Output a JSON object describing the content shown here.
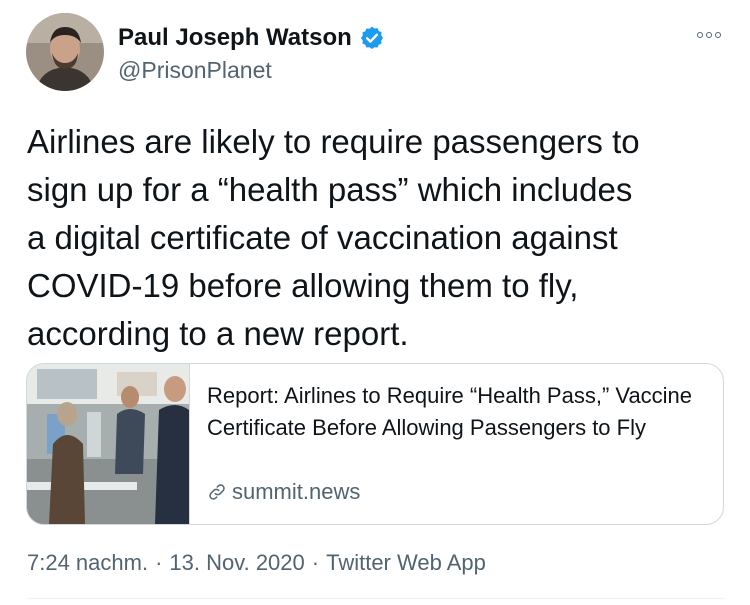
{
  "author": {
    "display_name": "Paul Joseph Watson",
    "handle": "@PrisonPlanet",
    "verified_icon": "verified-badge-icon",
    "avatar_icon": "profile-photo"
  },
  "more_icon": "more-options-icon",
  "tweet": {
    "text": "Airlines are likely to require passengers to\nsign up for a “health pass” which includes\na digital certificate of vaccination against\nCOVID-19 before allowing them to fly,\naccording to a new report."
  },
  "card": {
    "title": "Report: Airlines to Require “Health Pass,” Vaccine Certificate Before Allowing Passengers to Fly",
    "domain": "summit.news",
    "link_icon": "link-icon",
    "image": "airport-passengers-photo"
  },
  "meta": {
    "time": "7:24 nachm.",
    "separator": "·",
    "date": "13. Nov. 2020",
    "source": "Twitter Web App"
  },
  "colors": {
    "text": "#0f1419",
    "secondary": "#536471",
    "verified": "#1d9bf0",
    "border": "#cfd9de"
  }
}
